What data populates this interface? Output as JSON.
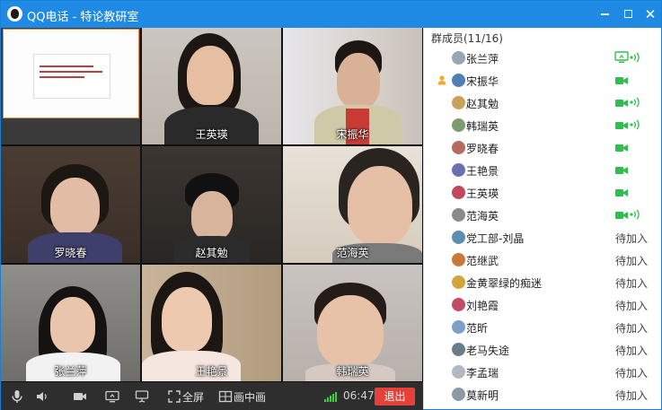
{
  "window": {
    "title": "QQ电话 - 特论教研室"
  },
  "video_tiles": [
    {
      "name": "",
      "kind": "screen-share"
    },
    {
      "name": "王英瑛"
    },
    {
      "name": "宋振华"
    },
    {
      "name": "罗晓春"
    },
    {
      "name": "赵其勉"
    },
    {
      "name": "范海英"
    },
    {
      "name": "张兰萍"
    },
    {
      "name": "王艳景"
    },
    {
      "name": "韩瑞英"
    }
  ],
  "toolbar": {
    "fullscreen_label": "全屏",
    "pip_label": "画中画",
    "timer": "06:47",
    "exit_label": "退出"
  },
  "members_panel": {
    "header": "群成员(11/16)",
    "members": [
      {
        "name": "张兰萍",
        "status": "screen+mic",
        "host": false
      },
      {
        "name": "宋振华",
        "status": "camera",
        "host": true
      },
      {
        "name": "赵其勉",
        "status": "camera+mic",
        "host": false
      },
      {
        "name": "韩瑞英",
        "status": "camera+mic",
        "host": false
      },
      {
        "name": "罗晓春",
        "status": "camera",
        "host": false
      },
      {
        "name": "王艳景",
        "status": "camera",
        "host": false
      },
      {
        "name": "王英瑛",
        "status": "camera",
        "host": false
      },
      {
        "name": "范海英",
        "status": "camera+mic",
        "host": false
      },
      {
        "name": "党工部-刘晶",
        "status": "待加入",
        "host": false
      },
      {
        "name": "范继武",
        "status": "待加入",
        "host": false
      },
      {
        "name": "金黄翠绿的痴迷",
        "status": "待加入",
        "host": false
      },
      {
        "name": "刘艳霞",
        "status": "待加入",
        "host": false
      },
      {
        "name": "范昕",
        "status": "待加入",
        "host": false
      },
      {
        "name": "老马失途",
        "status": "待加入",
        "host": false
      },
      {
        "name": "李孟瑞",
        "status": "待加入",
        "host": false
      },
      {
        "name": "莫新明",
        "status": "待加入",
        "host": false
      }
    ]
  },
  "colors": {
    "titlebar": "#1f8ae4",
    "status_green": "#2fbf4f",
    "exit_red": "#e3413a"
  }
}
